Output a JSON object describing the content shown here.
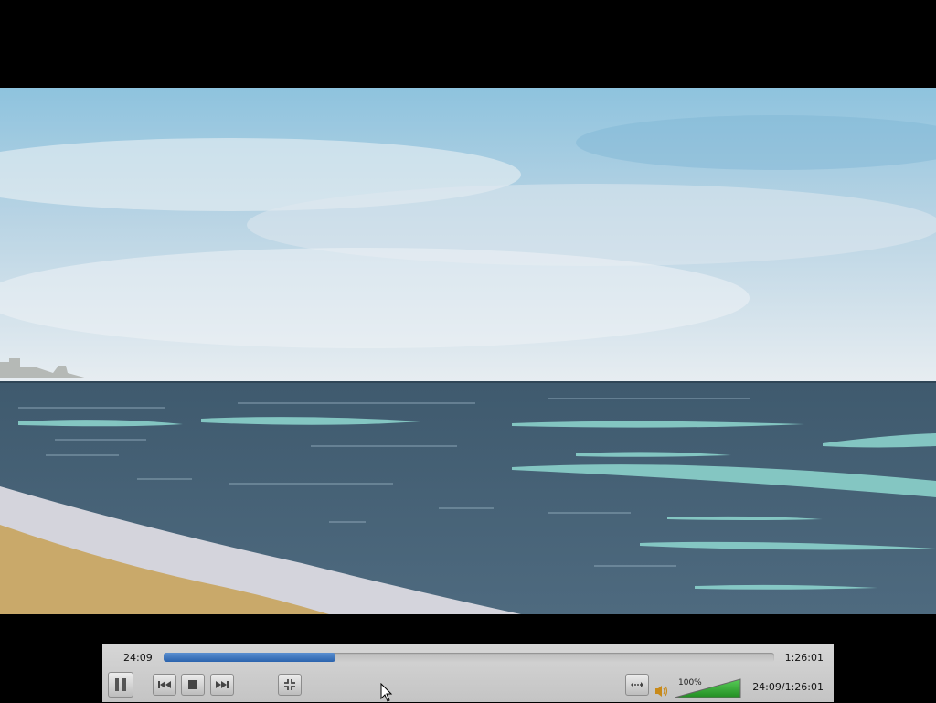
{
  "player": {
    "elapsed": "24:09",
    "total": "1:26:01",
    "combined": "24:09/1:26:01",
    "progress_fraction": 0.281,
    "volume_label": "100%",
    "volume_fraction": 1.0
  },
  "colors": {
    "sky_top": "#8ec3de",
    "sea": "#4a6478",
    "foam": "#8fd8d0",
    "sand": "#c9a96a",
    "seek_fill": "#2b63ad",
    "volume_fill": "#2fa82f"
  },
  "controls": {
    "buttons": [
      "pause-icon",
      "previous-icon",
      "stop-icon",
      "next-icon",
      "fullscreen-icon",
      "extended-settings-icon"
    ]
  }
}
